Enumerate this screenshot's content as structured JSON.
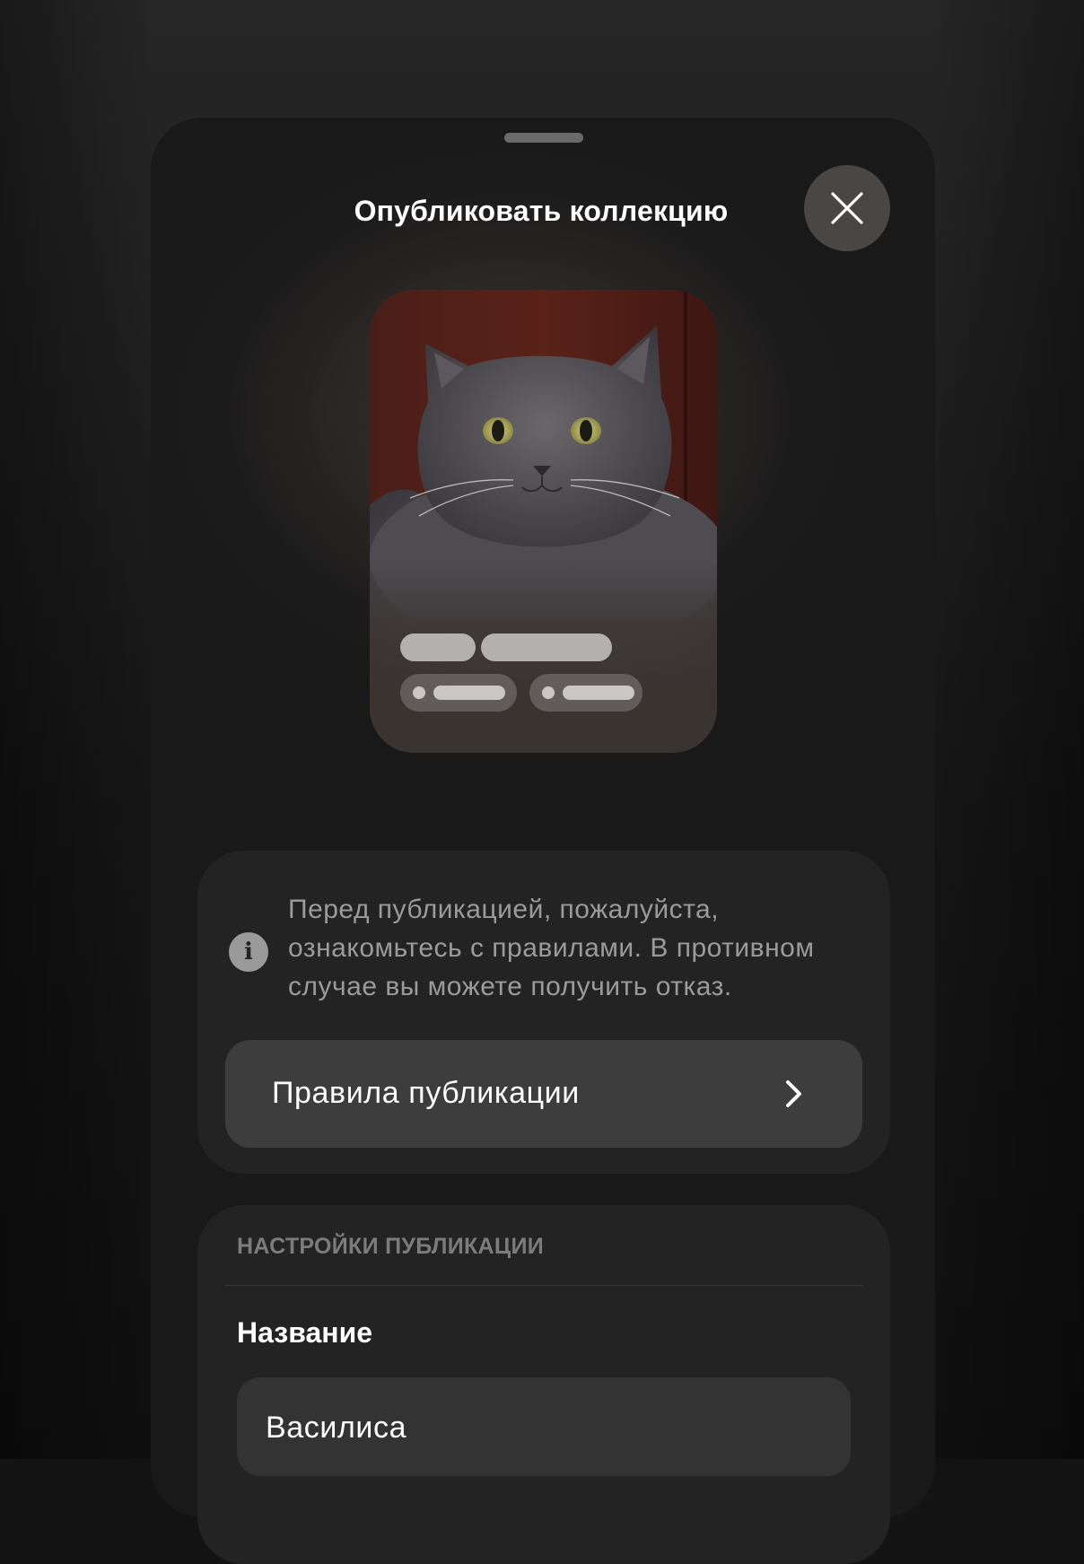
{
  "sheet": {
    "title": "Опубликовать коллекцию",
    "close_icon": "close-icon"
  },
  "preview": {
    "image": "cat-photo"
  },
  "notice": {
    "icon": "info-icon",
    "text": "Перед публикацией, пожалуйста, ознакомьтесь с правилами. В противном случае вы можете получить отказ.",
    "rules_button_label": "Правила публикации",
    "rules_button_icon": "chevron-right-icon"
  },
  "settings": {
    "header": "НАСТРОЙКИ ПУБЛИКАЦИИ",
    "name_label": "Название",
    "name_value": "Василиса"
  },
  "colors": {
    "sheet_background": "#1d1c1c",
    "card_background": "#232323",
    "row_background": "#3d3d3d",
    "secondary_text": "#9b9b9b"
  }
}
